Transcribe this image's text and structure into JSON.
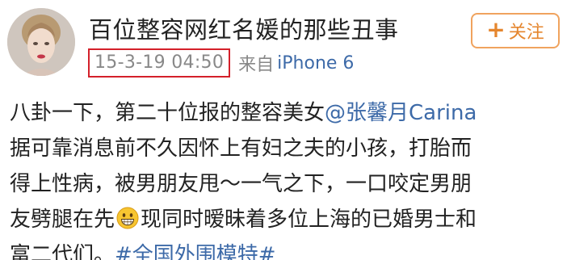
{
  "account": {
    "name": "百位整容网红名媛的那些丑事",
    "avatar_icon": "woman-portrait-avatar"
  },
  "follow_button": {
    "plus": "+",
    "label": "关注"
  },
  "meta": {
    "timestamp": "15-3-19 04:50",
    "source_prefix": "来自",
    "source_device": "iPhone 6"
  },
  "post": {
    "line1_text": "八卦一下，第二十位报的整容美女",
    "line1_mention": "@张馨月Carina",
    "line2": "据可靠消息前不久因怀上有妇之夫的小孩，打胎而",
    "line3": "得上性病，被男朋友甩～一气之下，一口咬定男朋",
    "line4_before": "友劈腿在先",
    "line4_emoji": "grinning-face-emoji",
    "line4_after": "现同时暧昧着多位上海的已婚男士和",
    "line5_text": "富二代们。",
    "line5_hashtag": "#全国外围模特#"
  },
  "colors": {
    "link": "#3d6aa8",
    "follow": "#e5862e",
    "highlight_box": "#d4202a",
    "meta_gray": "#888888"
  }
}
